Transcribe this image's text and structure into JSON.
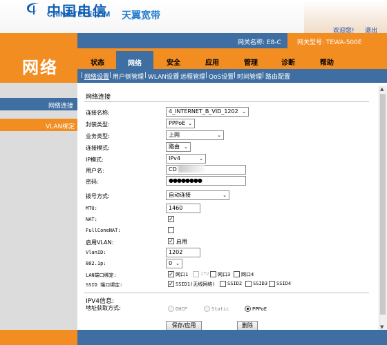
{
  "header": {
    "logo_cn": "中国电信",
    "logo_en": "CHINA TELECOM",
    "brand": "天翼宽带",
    "welcome": "欢迎您!",
    "logout": "退出"
  },
  "infobar": {
    "gateway_name": "网关名称:  E8-C",
    "gateway_model": "网关型号: TEWA-500E"
  },
  "section_title": "网络",
  "tabs": [
    "状态",
    "网络",
    "安全",
    "应用",
    "管理",
    "诊断",
    "帮助"
  ],
  "active_tab": "网络",
  "subnav": [
    "网络设置",
    "用户侧管理",
    "WLAN设置",
    "远程管理",
    "QoS设置",
    "时间管理",
    "路由配置"
  ],
  "sidebar": {
    "items": [
      {
        "label": "网络连接",
        "active": true
      },
      {
        "label": "VLAN绑定",
        "active": false
      }
    ]
  },
  "form": {
    "section": "网络连接",
    "fields": {
      "connection_name": {
        "label": "连接名称:",
        "value": "4_INTERNET_B_VID_1202"
      },
      "encapsulation": {
        "label": "封装类型:",
        "value": "PPPoE"
      },
      "service_type": {
        "label": "业务类型:",
        "value": "上网"
      },
      "connection_mode": {
        "label": "连接模式:",
        "value": "路由"
      },
      "ip_mode": {
        "label": "IP模式:",
        "value": "IPv4"
      },
      "username": {
        "label": "用户名:",
        "value": "CD"
      },
      "password": {
        "label": "密码:",
        "value": "●●●●●●●●"
      },
      "dial_mode": {
        "label": "拨号方式:",
        "value": "自动连接"
      },
      "mtu": {
        "label": "MTU:",
        "value": "1460"
      },
      "nat": {
        "label": "NAT:",
        "checked": true
      },
      "full_cone_nat": {
        "label": "FullConeNAT:",
        "checked": false
      },
      "enable_vlan": {
        "label": "启用VLAN:",
        "checked": true,
        "text": "启用"
      },
      "vlan_id": {
        "label": "VlanID:",
        "value": "1202"
      },
      "dot1p": {
        "label": "802.1p:",
        "value": "0"
      },
      "lan_bind": {
        "label": "LAN端口绑定:",
        "ports": [
          {
            "name": "网口1",
            "checked": true,
            "disabled": false
          },
          {
            "name": "iTV",
            "checked": false,
            "disabled": true
          },
          {
            "name": "网口3",
            "checked": false,
            "disabled": false
          },
          {
            "name": "网口4",
            "checked": false,
            "disabled": false
          }
        ]
      },
      "ssid_bind": {
        "label": "SSID 端口绑定:",
        "ports": [
          {
            "name": "SSID1(无线网络)",
            "checked": true
          },
          {
            "name": "SSID2",
            "checked": false
          },
          {
            "name": "SSID3",
            "checked": false
          },
          {
            "name": "SSID4",
            "checked": false
          }
        ]
      }
    },
    "ipv4": {
      "section": "IPV4信息:",
      "addr_label": "地址获取方式:",
      "options": [
        {
          "name": "DHCP",
          "selected": false
        },
        {
          "name": "Static",
          "selected": false
        },
        {
          "name": "PPPoE",
          "selected": true
        }
      ]
    },
    "buttons": {
      "save": "保存/应用",
      "delete": "删除"
    }
  },
  "colors": {
    "orange": "#f28d22",
    "blue": "#3f6fa2",
    "logo_blue": "#1160b6"
  }
}
